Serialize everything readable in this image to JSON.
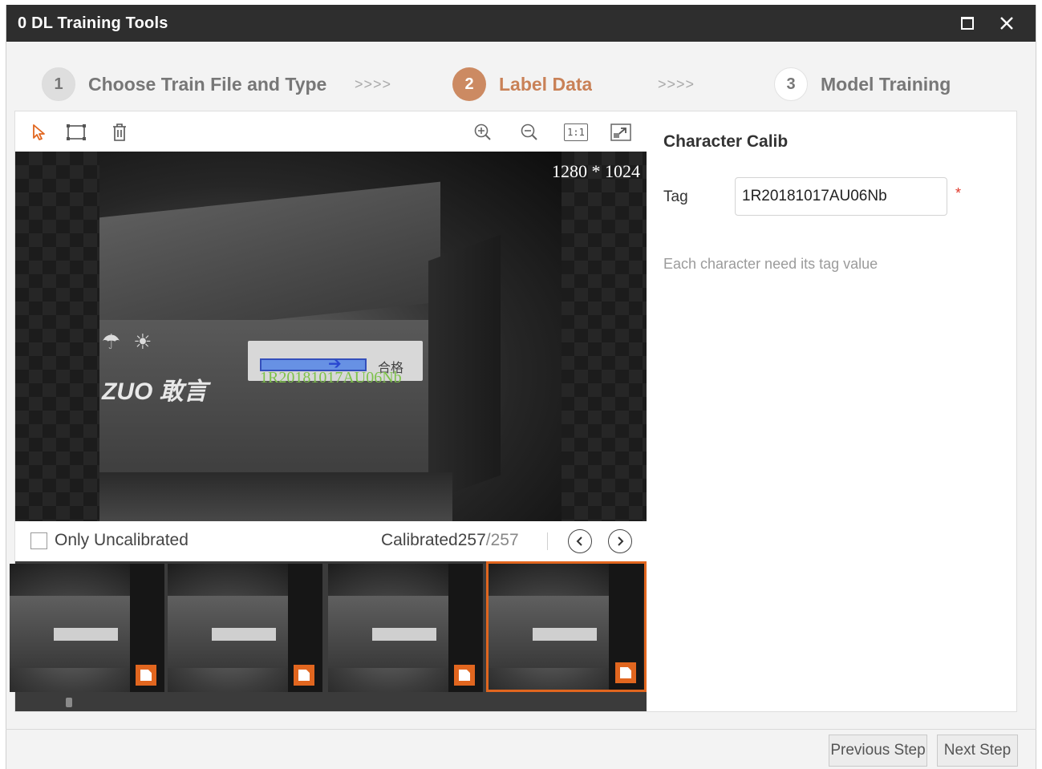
{
  "window": {
    "title": "0 DL Training Tools",
    "icons": {
      "maximize": "maximize-icon",
      "close": "close-icon"
    }
  },
  "steps": [
    {
      "num": "1",
      "label": "Choose Train File and Type"
    },
    {
      "num": "2",
      "label": "Label Data"
    },
    {
      "num": "3",
      "label": "Model Training"
    }
  ],
  "step_separator": ">>>>",
  "toolbar": {
    "tools": [
      "select-arrow-icon",
      "rectangle-tool-icon",
      "delete-icon",
      "zoom-in-icon",
      "zoom-out-icon",
      "actual-size-icon",
      "fit-window-icon"
    ],
    "actual_size_label": "1:1"
  },
  "viewer": {
    "resolution": "1280 * 1024",
    "roi_text": "1R20181017AU06Nb",
    "label_card_text": "合格",
    "brand_text": "ZUO 敢言"
  },
  "status": {
    "only_uncalibrated_label": "Only Uncalibrated",
    "only_uncalibrated_checked": false,
    "calibrated_prefix": "Calibrated",
    "calibrated_count": "257",
    "total_count": "/257"
  },
  "thumbnails": [
    {
      "selected": false
    },
    {
      "selected": false
    },
    {
      "selected": false
    },
    {
      "selected": true
    }
  ],
  "right_panel": {
    "title": "Character Calib",
    "tag_label": "Tag",
    "tag_value": "1R20181017AU06Nb",
    "required_mark": "*",
    "hint": "Each character need its tag value"
  },
  "footer": {
    "previous_label": "Previous Step",
    "next_label": "Next Step"
  },
  "colors": {
    "accent": "#e1661f",
    "step_active": "#cc8a62",
    "titlebar": "#2e2e2e",
    "required": "#e0392b",
    "roi_fill": "#5b8ae6",
    "roi_text": "#7dc24a"
  }
}
